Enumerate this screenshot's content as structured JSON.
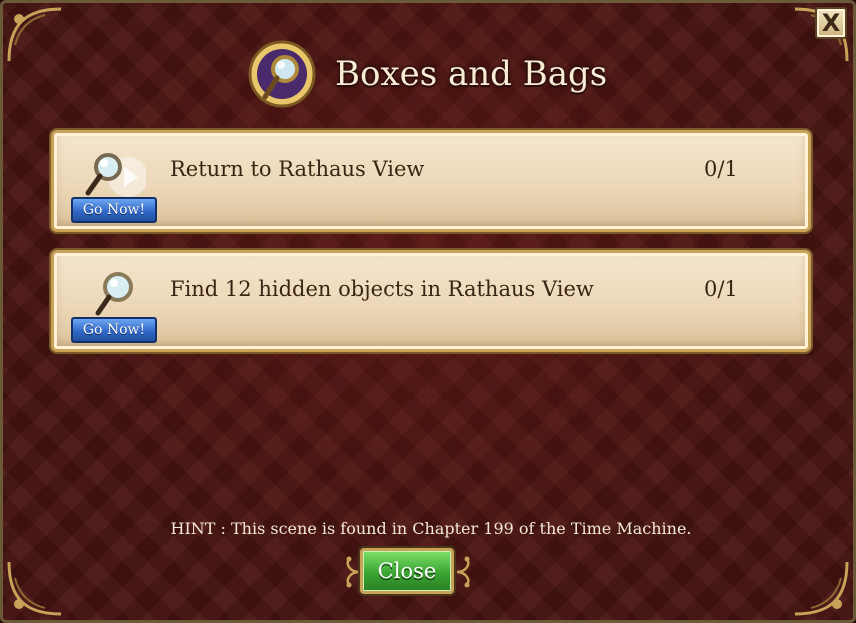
{
  "dialog": {
    "title": "Boxes and Bags",
    "close_x_label": "X"
  },
  "quests": [
    {
      "text": "Return to Rathaus View",
      "progress": "0/1",
      "button_label": "Go Now!",
      "icon": "magnifier-play-icon"
    },
    {
      "text": "Find 12 hidden objects in Rathaus View",
      "progress": "0/1",
      "button_label": "Go Now!",
      "icon": "magnifier-icon"
    }
  ],
  "hint": "HINT : This scene is found in Chapter 199 of the Time Machine.",
  "close_button_label": "Close",
  "colors": {
    "background": "#4a1512",
    "panel": "#f5e6ce",
    "go_button": "#2f66c6",
    "close_button": "#3aa532",
    "gold_border": "#c9a25a"
  }
}
